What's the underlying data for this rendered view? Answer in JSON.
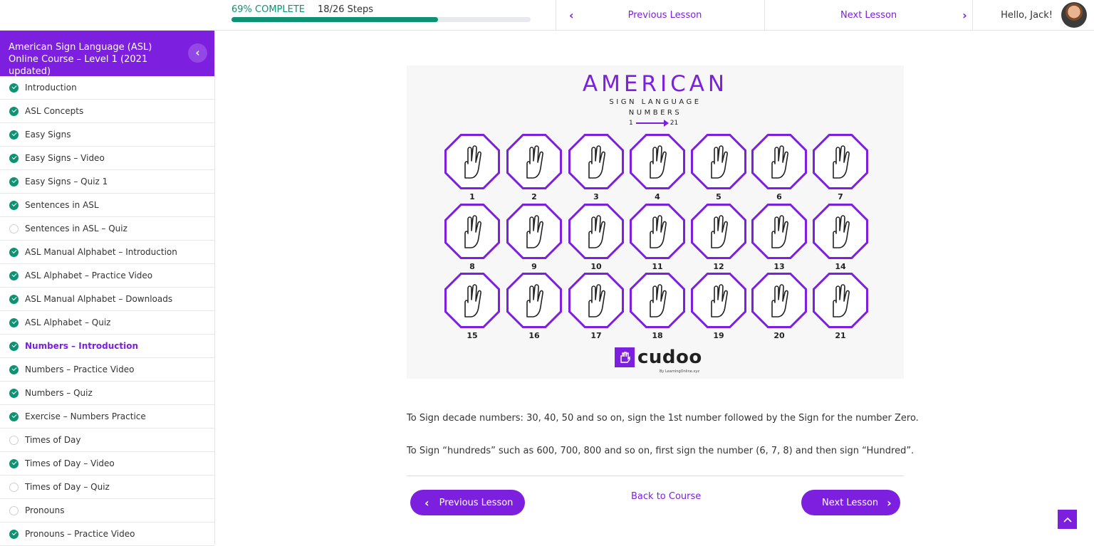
{
  "progress": {
    "percent_label": "69% COMPLETE",
    "steps_label": "18/26 Steps",
    "fraction": 0.69
  },
  "topnav": {
    "previous_label": "Previous Lesson",
    "next_label": "Next Lesson",
    "greeting": "Hello, Jack!"
  },
  "sidebar": {
    "course_title": "American Sign Language (ASL) Online Course – Level 1 (2021 updated)",
    "lessons": [
      {
        "label": "Introduction",
        "complete": true
      },
      {
        "label": "ASL Concepts",
        "complete": true
      },
      {
        "label": "Easy Signs",
        "complete": true
      },
      {
        "label": "Easy Signs – Video",
        "complete": true
      },
      {
        "label": "Easy Signs – Quiz 1",
        "complete": true
      },
      {
        "label": "Sentences in ASL",
        "complete": true
      },
      {
        "label": "Sentences in ASL – Quiz",
        "complete": false
      },
      {
        "label": "ASL Manual Alphabet – Introduction",
        "complete": true
      },
      {
        "label": "ASL Alphabet – Practice Video",
        "complete": true
      },
      {
        "label": "ASL Manual Alphabet – Downloads",
        "complete": true
      },
      {
        "label": "ASL Alphabet – Quiz",
        "complete": true
      },
      {
        "label": "Numbers – Introduction",
        "complete": true,
        "current": true
      },
      {
        "label": "Numbers – Practice Video",
        "complete": true
      },
      {
        "label": "Numbers – Quiz",
        "complete": true
      },
      {
        "label": "Exercise – Numbers Practice",
        "complete": true
      },
      {
        "label": "Times of Day",
        "complete": false
      },
      {
        "label": "Times of Day – Video",
        "complete": true
      },
      {
        "label": "Times of Day – Quiz",
        "complete": false
      },
      {
        "label": "Pronouns",
        "complete": false
      },
      {
        "label": "Pronouns – Practice Video",
        "complete": true
      }
    ]
  },
  "figure": {
    "title": "AMERICAN",
    "subtitle_1": "SIGN LANGUAGE",
    "subtitle_2": "NUMBERS",
    "range_start": "1",
    "range_end": "21",
    "signs": [
      "1",
      "2",
      "3",
      "4",
      "5",
      "6",
      "7",
      "8",
      "9",
      "10",
      "11",
      "12",
      "13",
      "14",
      "15",
      "16",
      "17",
      "18",
      "19",
      "20",
      "21"
    ],
    "brand": "cudoo",
    "brand_tagline": "By LearningOnline.xyz"
  },
  "content": {
    "paragraph_1": "To Sign decade numbers: 30, 40, 50 and so on, sign the 1st number followed by the Sign for the number Zero.",
    "paragraph_2": "To Sign “hundreds” such as 600, 700, 800 and so on, first sign the number (6, 7, 8) and then sign “Hundred”."
  },
  "footer_nav": {
    "previous_label": "Previous Lesson",
    "back_label": "Back to Course",
    "next_label": "Next Lesson"
  },
  "colors": {
    "accent": "#7c1fdf",
    "success": "#0d9373"
  }
}
